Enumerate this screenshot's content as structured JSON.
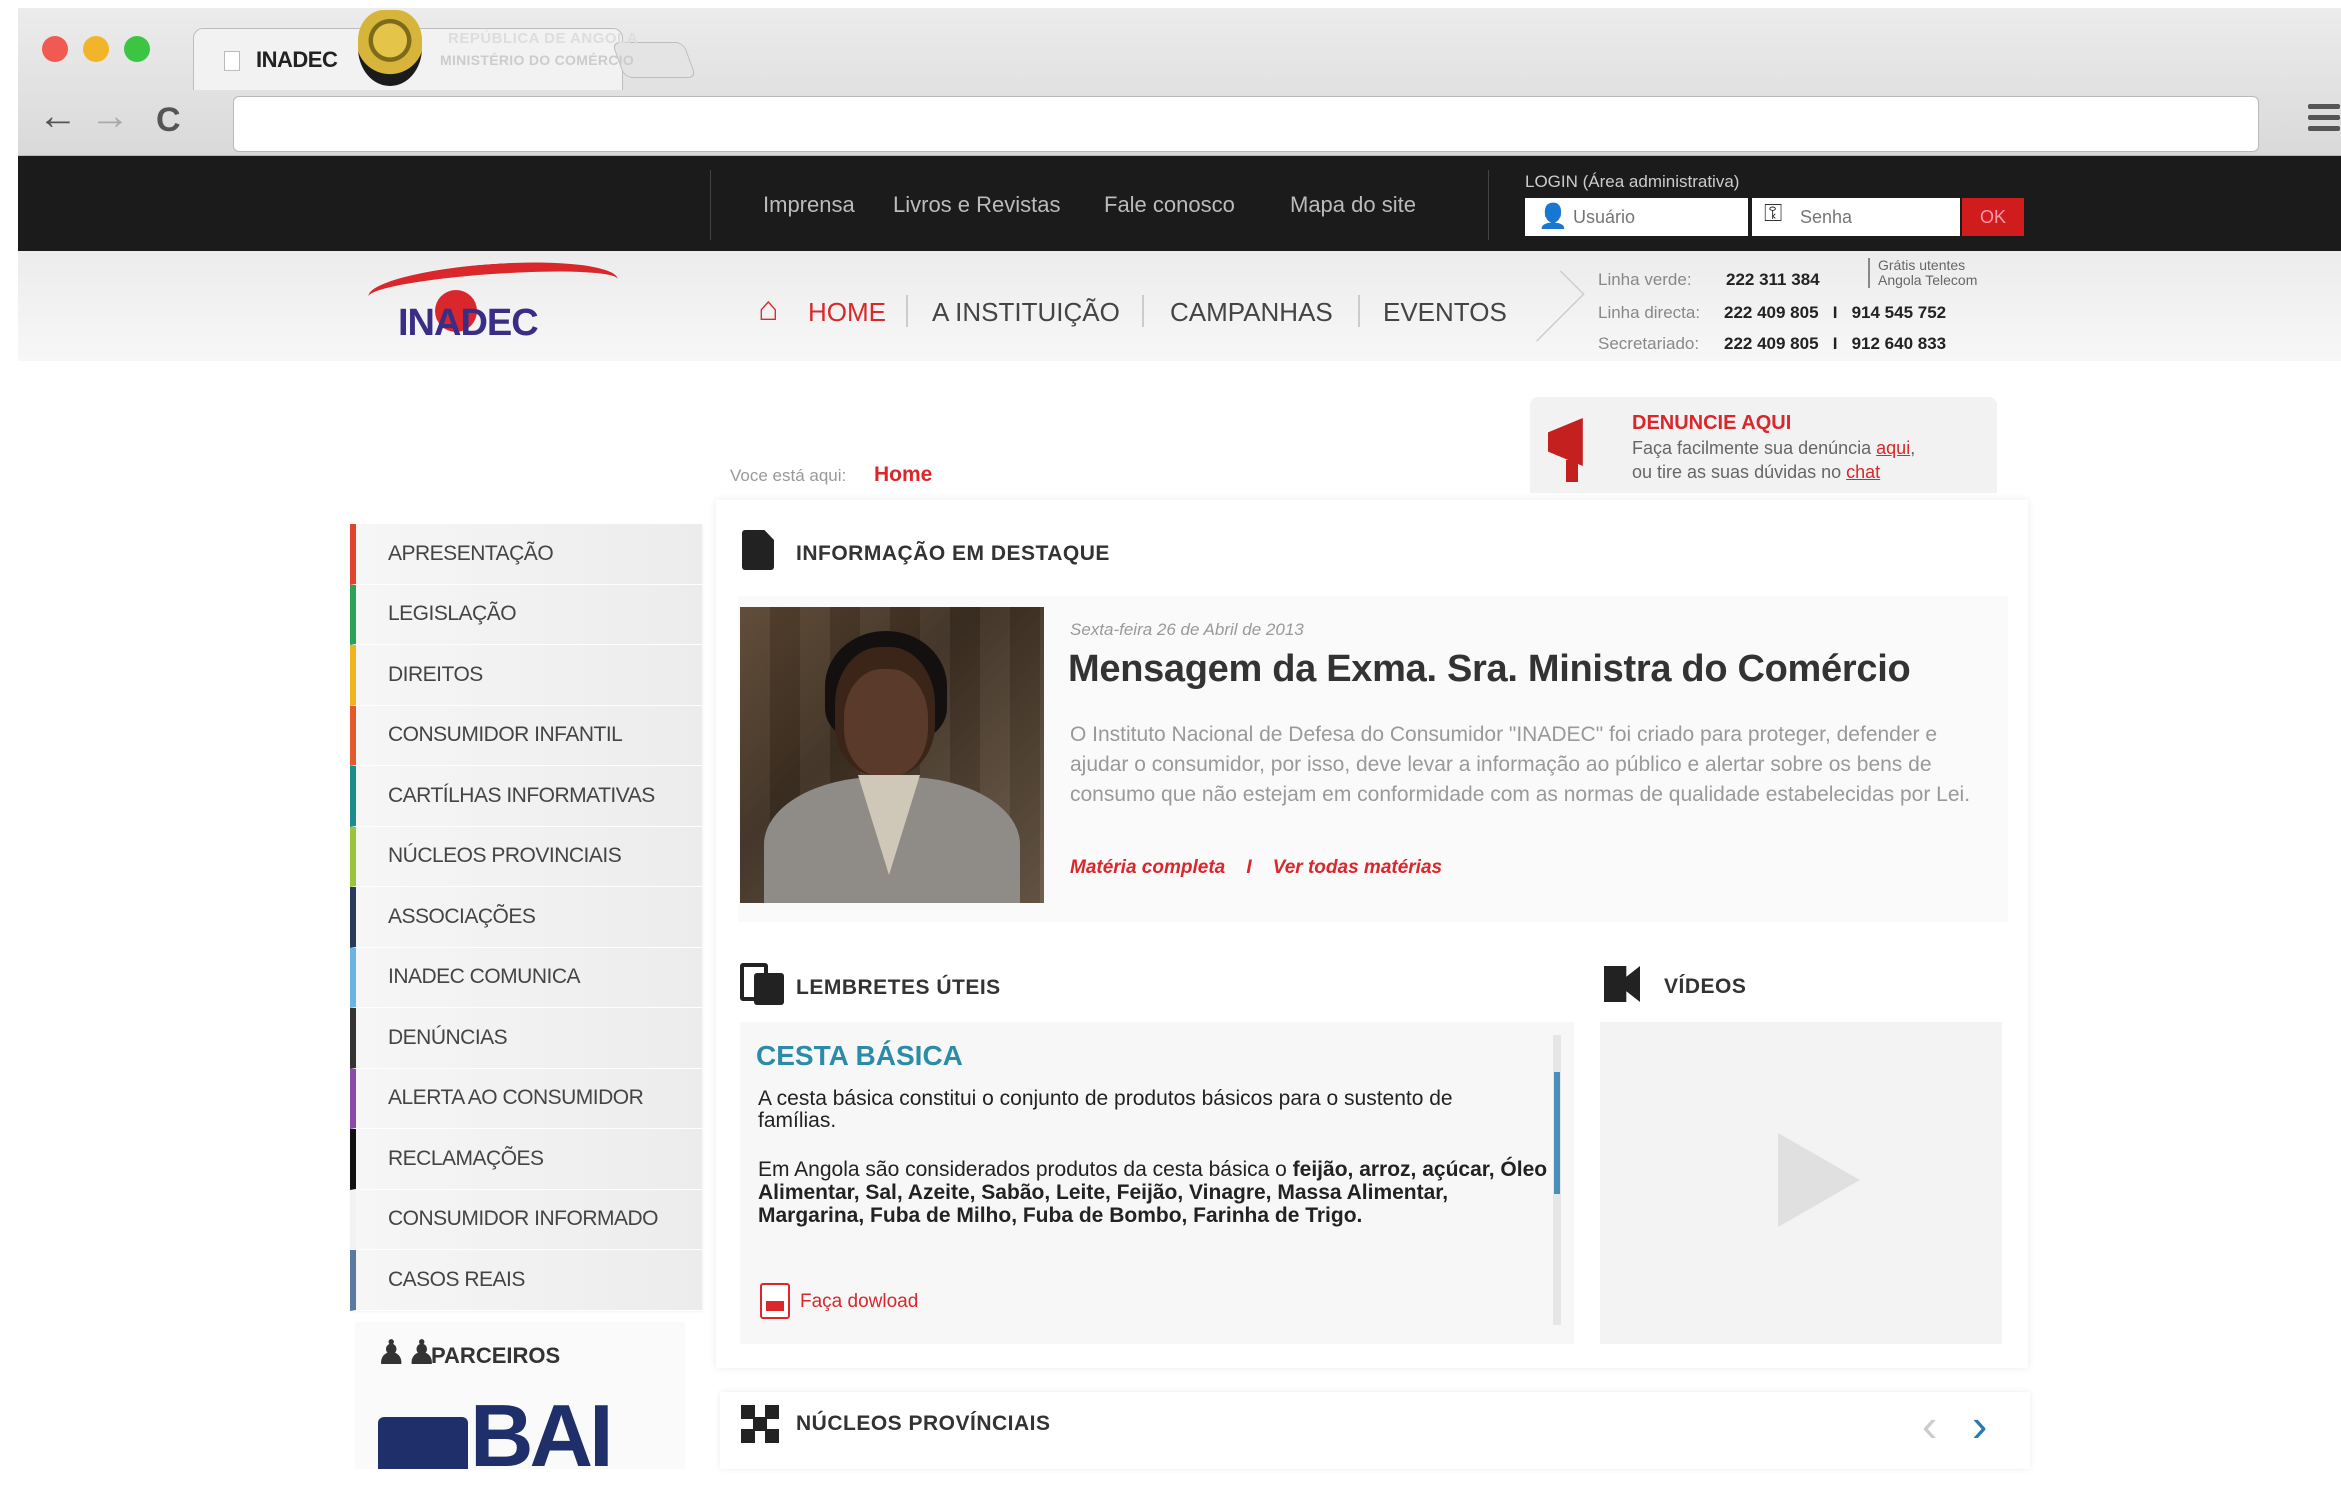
{
  "browser": {
    "tab_title": "INADEC",
    "back_icon": "←",
    "forward_icon": "→",
    "reload_icon": "C"
  },
  "topbar": {
    "republic_line1": "REPÚBLICA DE ANGOLA",
    "republic_line2": "MINISTÉRIO DO COMÉRCIO",
    "links": [
      "Imprensa",
      "Livros e Revistas",
      "Fale conosco",
      "Mapa do site"
    ],
    "login_label": "LOGIN (Área administrativa)",
    "user_placeholder": "Usuário",
    "pass_placeholder": "Senha",
    "ok_label": "OK"
  },
  "header": {
    "logo_text": "INADEC",
    "nav": [
      "HOME",
      "A INSTITUIÇÃO",
      "CAMPANHAS",
      "EVENTOS"
    ],
    "contacts": [
      {
        "label": "Linha verde:",
        "numbers": "222 311 384"
      },
      {
        "label": "Linha directa:",
        "numbers": "222 409 805   I   914 545 752"
      },
      {
        "label": "Secretariado:",
        "numbers": "222 409 805   I   912 640 833"
      }
    ],
    "gratis_note_1": "Grátis utentes",
    "gratis_note_2": "Angola Telecom"
  },
  "denuncie": {
    "title": "DENUNCIE AQUI",
    "line1_pre": "Faça facilmente sua denúncia ",
    "line1_link": "aqui",
    "line1_post": ",",
    "line2_pre": "ou tire as suas dúvidas no ",
    "line2_link": "chat"
  },
  "breadcrumb": {
    "label": "Voce está aqui:",
    "current": "Home"
  },
  "sidebar": {
    "items": [
      {
        "label": "APRESENTAÇÃO",
        "color": "#e0442f"
      },
      {
        "label": "LEGISLAÇÃO",
        "color": "#2aa25a"
      },
      {
        "label": "DIREITOS",
        "color": "#f0b41f"
      },
      {
        "label": "CONSUMIDOR INFANTIL",
        "color": "#e35b2d"
      },
      {
        "label": "CARTÍLHAS INFORMATIVAS",
        "color": "#1e8c8c"
      },
      {
        "label": "NÚCLEOS PROVINCIAIS",
        "color": "#9bc43b"
      },
      {
        "label": "ASSOCIAÇÕES",
        "color": "#2a3a5a"
      },
      {
        "label": "INADEC COMUNICA",
        "color": "#6cb3e0"
      },
      {
        "label": "DENÚNCIAS",
        "color": "#333333"
      },
      {
        "label": "ALERTA AO CONSUMIDOR",
        "color": "#8a4aa8"
      },
      {
        "label": "RECLAMAÇÕES",
        "color": "#111111"
      },
      {
        "label": "CONSUMIDOR INFORMADO",
        "color": "#f2f2f2"
      },
      {
        "label": "CASOS REAIS",
        "color": "#5a7aa0"
      }
    ],
    "parceiros_title": "PARCEIROS",
    "bai_text": "BAI"
  },
  "destaque": {
    "section_title": "INFORMAÇÃO EM DESTAQUE",
    "date": "Sexta-feira 26 de Abril de 2013",
    "title": "Mensagem da Exma. Sra. Ministra do Comércio",
    "body": "O Instituto Nacional de Defesa do Consumidor \"INADEC\" foi criado para proteger, defender e ajudar o consumidor, por isso, deve levar a informação ao público e alertar sobre os bens de consumo que não estejam em conformidade com as normas de qualidade estabelecidas por Lei.",
    "link1": "Matéria completa",
    "link_sep": "I",
    "link2": "Ver todas matérias"
  },
  "lembretes": {
    "section_title": "LEMBRETES ÚTEIS",
    "item_title": "CESTA BÁSICA",
    "p1": "A cesta básica constitui o conjunto de produtos básicos para o sustento de famílias.",
    "p2_pre": "Em Angola são considerados produtos da cesta básica o ",
    "p2_bold": "feijão, arroz, açúcar, Óleo Alimentar, Sal, Azeite, Sabão, Leite, Feijão, Vinagre, Massa Alimentar, Margarina, Fuba de Milho, Fuba de Bombo, Farinha de Trigo.",
    "download": "Faça dowload"
  },
  "videos": {
    "section_title": "VÍDEOS"
  },
  "nucleos": {
    "section_title": "NÚCLEOS PROVÍNCIAIS",
    "prev_icon": "‹",
    "next_icon": "›"
  }
}
